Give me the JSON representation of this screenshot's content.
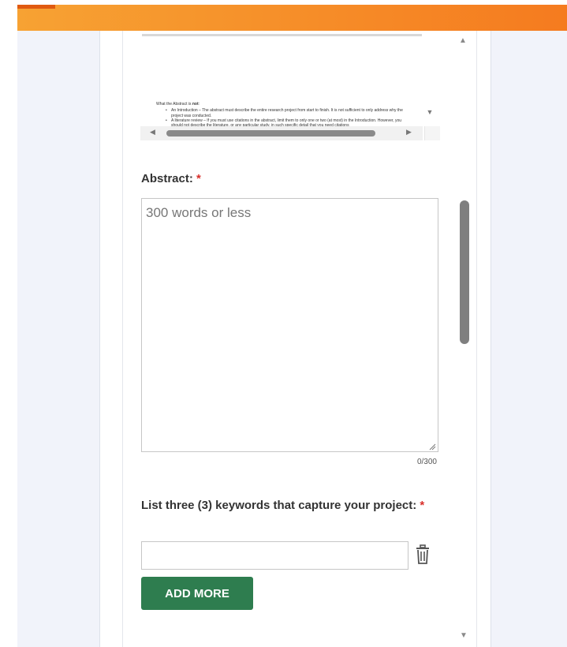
{
  "header": {
    "accent_color": "#f57b1f"
  },
  "document_preview": {
    "heading_prefix": "What the Abstract is ",
    "heading_emphasis": "not",
    "heading_suffix": ":",
    "bullets": [
      "An Introduction – The abstract must describe the entire research project from start to finish. It is not sufficient to only address why the project was conducted.",
      "A literature review – If you must use citations in the abstract, limit them to only one or two (at most) in the Introduction. However, you should not describe the literature, or any particular study, in such specific detail that you need citations"
    ]
  },
  "form": {
    "abstract": {
      "label": "Abstract:",
      "required_marker": "*",
      "placeholder": "300 words or less",
      "value": "",
      "word_count": "0/300"
    },
    "keywords": {
      "label": "List three (3) keywords that capture your project:",
      "required_marker": "*",
      "value": "",
      "delete_icon": "trash-icon"
    },
    "add_more_label": "ADD MORE",
    "button_color": "#2e7d4f"
  }
}
